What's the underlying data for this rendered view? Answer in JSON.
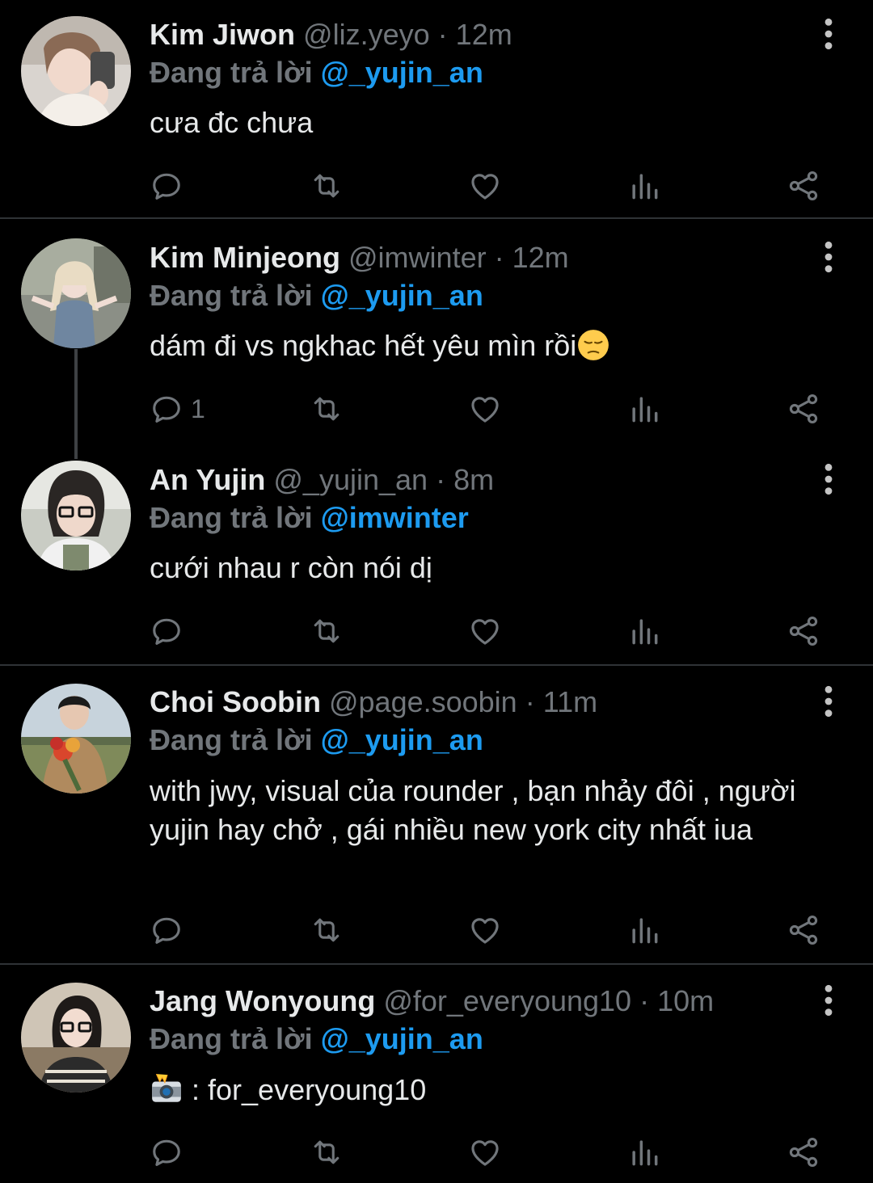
{
  "colors": {
    "background": "#000000",
    "text": "#e7e9ea",
    "muted": "#71767b",
    "link": "#1d9bf0",
    "divider": "#2f3336"
  },
  "tweets": [
    {
      "name": "Kim Jiwon",
      "handle": "@liz.yeyo",
      "separator": "·",
      "time": "12m",
      "reply_prefix": "Đang trả lời",
      "reply_to": "@_yujin_an",
      "text": "cưa đc chưa",
      "reply_count": "",
      "icons": [
        "reply-icon",
        "retweet-icon",
        "like-icon",
        "analytics-icon",
        "share-icon",
        "more-icon"
      ]
    },
    {
      "name": "Kim Minjeong",
      "handle": "@imwinter",
      "separator": "·",
      "time": "12m",
      "reply_prefix": "Đang trả lời",
      "reply_to": "@_yujin_an",
      "text": "dám đi vs ngkhac hết yêu mìn rồi",
      "trailing_emoji": "pensive-face-emoji",
      "reply_count": "1"
    },
    {
      "name": "An Yujin",
      "handle": "@_yujin_an",
      "separator": "·",
      "time": "8m",
      "reply_prefix": "Đang trả lời",
      "reply_to": "@imwinter",
      "text": "cưới nhau r còn nói dị",
      "reply_count": ""
    },
    {
      "name": "Choi Soobin",
      "handle": "@page.soobin",
      "separator": "·",
      "time": "11m",
      "reply_prefix": "Đang trả lời",
      "reply_to": "@_yujin_an",
      "text": "with jwy, visual của rounder , bạn nhảy đôi , người yujin hay chở , gái nhiều new york city nhất iua",
      "reply_count": ""
    },
    {
      "name": "Jang Wonyoung",
      "handle": "@for_everyoung10",
      "separator": "·",
      "time": "10m",
      "reply_prefix": "Đang trả lời",
      "reply_to": "@_yujin_an",
      "leading_emoji": "camera-flash-emoji",
      "text": ": for_everyoung10",
      "reply_count": ""
    }
  ]
}
